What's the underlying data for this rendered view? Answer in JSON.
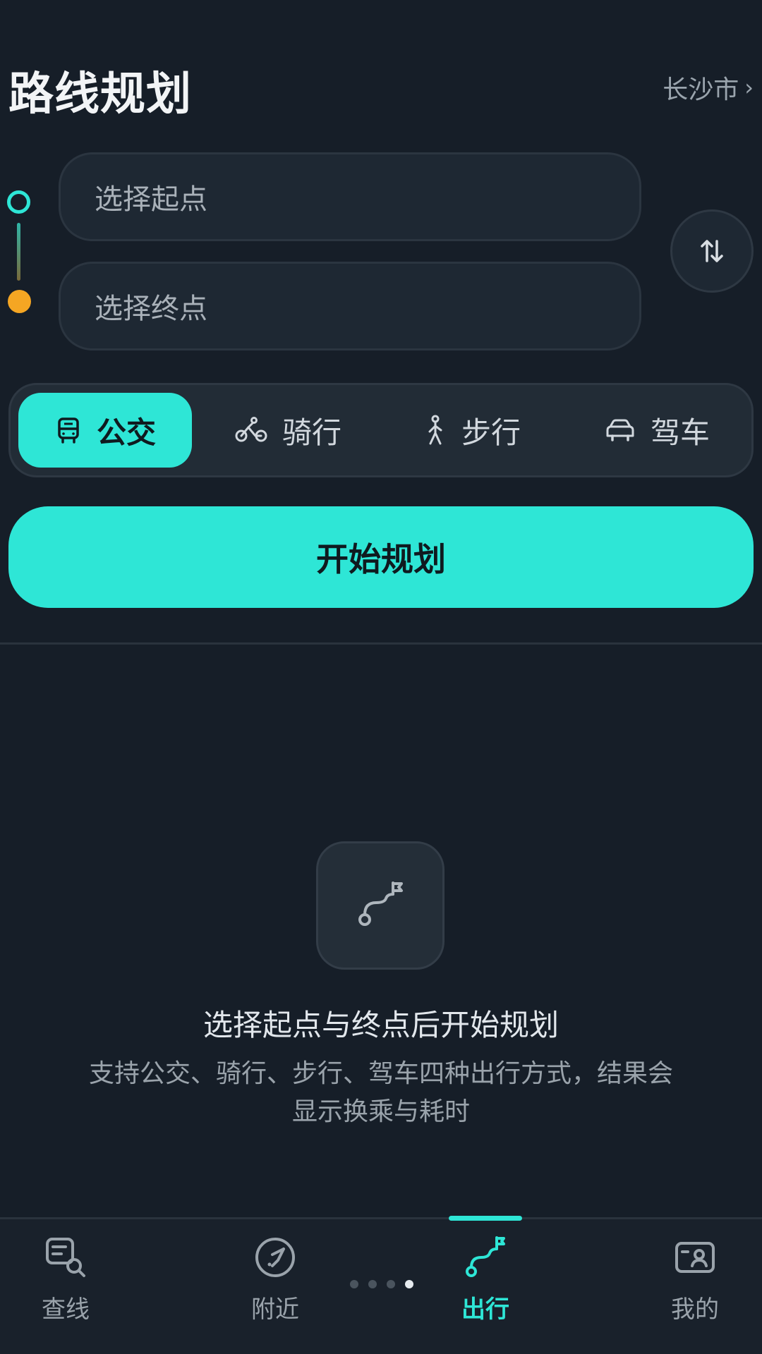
{
  "header": {
    "title": "路线规划",
    "city": "长沙市"
  },
  "route": {
    "start_placeholder": "选择起点",
    "end_placeholder": "选择终点",
    "swap_icon": "swap-vertical-icon"
  },
  "modes": [
    {
      "label": "公交",
      "icon": "bus-icon",
      "active": true
    },
    {
      "label": "骑行",
      "icon": "bike-icon",
      "active": false
    },
    {
      "label": "步行",
      "icon": "walk-icon",
      "active": false
    },
    {
      "label": "驾车",
      "icon": "car-icon",
      "active": false
    }
  ],
  "start_button": {
    "label": "开始规划"
  },
  "empty_state": {
    "icon": "route-icon",
    "title": "选择起点与终点后开始规划",
    "description": "支持公交、骑行、步行、驾车四种出行方式，结果会显示换乘与耗时"
  },
  "bottom_nav": {
    "items": [
      {
        "label": "查线",
        "icon": "line-search-icon",
        "active": false
      },
      {
        "label": "附近",
        "icon": "compass-icon",
        "active": false
      },
      {
        "label": "出行",
        "icon": "route-icon",
        "active": true
      },
      {
        "label": "我的",
        "icon": "profile-card-icon",
        "active": false
      }
    ],
    "page_dots": 4,
    "active_dot": 4
  },
  "colors": {
    "background": "#161e28",
    "accent": "#2ee6d6",
    "start_dot": "#2ee6d6",
    "end_dot": "#f5a623"
  }
}
